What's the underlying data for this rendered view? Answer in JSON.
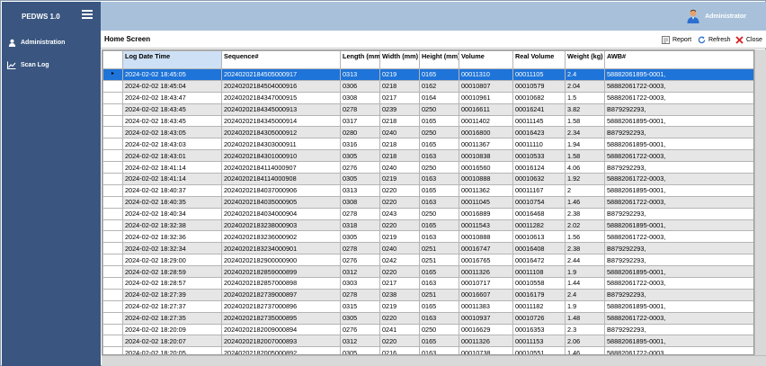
{
  "app": {
    "title": "PEDWS 1.0"
  },
  "sidebar": {
    "items": [
      {
        "label": "Administration",
        "icon": "user-icon"
      },
      {
        "label": "Scan Log",
        "icon": "chart-icon"
      }
    ]
  },
  "topbar": {
    "user_name": "Administrator"
  },
  "page": {
    "title": "Home Screen",
    "buttons": {
      "report": "Report",
      "refresh": "Refresh",
      "close": "Close"
    }
  },
  "colors": {
    "sidebar": "#3a5680",
    "topbar": "#a8c0d9",
    "selected_row": "#1e74d8",
    "sorted_header": "#cde0f5"
  },
  "table": {
    "columns": [
      "Log Date Time",
      "Sequence#",
      "Length (mm)",
      "Width (mm)",
      "Height (mm)",
      "Volume",
      "Real Volume",
      "Weight (kg)",
      "AWB#"
    ],
    "rows": [
      [
        "2024-02-02 18:45:05",
        "20240202184505000917",
        "0313",
        "0219",
        "0165",
        "00011310",
        "00011105",
        "2.4",
        "58882061895-0001,"
      ],
      [
        "2024-02-02 18:45:04",
        "20240202184504000916",
        "0306",
        "0218",
        "0162",
        "00010807",
        "00010579",
        "2.04",
        "58882061722-0003,"
      ],
      [
        "2024-02-02 18:43:47",
        "20240202184347000915",
        "0308",
        "0217",
        "0164",
        "00010961",
        "00010682",
        "1.5",
        "58882061722-0003,"
      ],
      [
        "2024-02-02 18:43:45",
        "20240202184345000913",
        "0278",
        "0239",
        "0250",
        "00016611",
        "00016241",
        "3.82",
        "B879292293,"
      ],
      [
        "2024-02-02 18:43:45",
        "20240202184345000914",
        "0317",
        "0218",
        "0165",
        "00011402",
        "00011145",
        "1.58",
        "58882061895-0001,"
      ],
      [
        "2024-02-02 18:43:05",
        "20240202184305000912",
        "0280",
        "0240",
        "0250",
        "00016800",
        "00016423",
        "2.34",
        "B879292293,"
      ],
      [
        "2024-02-02 18:43:03",
        "20240202184303000911",
        "0316",
        "0218",
        "0165",
        "00011367",
        "00011110",
        "1.94",
        "58882061895-0001,"
      ],
      [
        "2024-02-02 18:43:01",
        "20240202184301000910",
        "0305",
        "0218",
        "0163",
        "00010838",
        "00010533",
        "1.58",
        "58882061722-0003,"
      ],
      [
        "2024-02-02 18:41:14",
        "20240202184114000907",
        "0276",
        "0240",
        "0250",
        "00016560",
        "00016124",
        "4.06",
        "B879292293,"
      ],
      [
        "2024-02-02 18:41:14",
        "20240202184114000908",
        "0305",
        "0219",
        "0163",
        "00010888",
        "00010632",
        "1.92",
        "58882061722-0003,"
      ],
      [
        "2024-02-02 18:40:37",
        "20240202184037000906",
        "0313",
        "0220",
        "0165",
        "00011362",
        "00011167",
        "2",
        "58882061895-0001,"
      ],
      [
        "2024-02-02 18:40:35",
        "20240202184035000905",
        "0308",
        "0220",
        "0163",
        "00011045",
        "00010754",
        "1.46",
        "58882061722-0003,"
      ],
      [
        "2024-02-02 18:40:34",
        "20240202184034000904",
        "0278",
        "0243",
        "0250",
        "00016889",
        "00016468",
        "2.38",
        "B879292293,"
      ],
      [
        "2024-02-02 18:32:38",
        "20240202183238000903",
        "0318",
        "0220",
        "0165",
        "00011543",
        "00011282",
        "2.02",
        "58882061895-0001,"
      ],
      [
        "2024-02-02 18:32:36",
        "20240202183236000902",
        "0305",
        "0219",
        "0163",
        "00010888",
        "00010613",
        "1.56",
        "58882061722-0003,"
      ],
      [
        "2024-02-02 18:32:34",
        "20240202183234000901",
        "0278",
        "0240",
        "0251",
        "00016747",
        "00016408",
        "2.38",
        "B879292293,"
      ],
      [
        "2024-02-02 18:29:00",
        "20240202182900000900",
        "0276",
        "0242",
        "0251",
        "00016765",
        "00016472",
        "2.44",
        "B879292293,"
      ],
      [
        "2024-02-02 18:28:59",
        "20240202182859000899",
        "0312",
        "0220",
        "0165",
        "00011326",
        "00011108",
        "1.9",
        "58882061895-0001,"
      ],
      [
        "2024-02-02 18:28:57",
        "20240202182857000898",
        "0303",
        "0217",
        "0163",
        "00010717",
        "00010558",
        "1.44",
        "58882061722-0003,"
      ],
      [
        "2024-02-02 18:27:39",
        "20240202182739000897",
        "0278",
        "0238",
        "0251",
        "00016607",
        "00016179",
        "2.4",
        "B879292293,"
      ],
      [
        "2024-02-02 18:27:37",
        "20240202182737000896",
        "0315",
        "0219",
        "0165",
        "00011383",
        "00011182",
        "1.9",
        "58882061895-0001,"
      ],
      [
        "2024-02-02 18:27:35",
        "20240202182735000895",
        "0305",
        "0220",
        "0163",
        "00010937",
        "00010726",
        "1.48",
        "58882061722-0003,"
      ],
      [
        "2024-02-02 18:20:09",
        "20240202182009000894",
        "0276",
        "0241",
        "0250",
        "00016629",
        "00016353",
        "2.3",
        "B879292293,"
      ],
      [
        "2024-02-02 18:20:07",
        "20240202182007000893",
        "0312",
        "0220",
        "0165",
        "00011326",
        "00011153",
        "2.06",
        "58882061895-0001,"
      ],
      [
        "2024-02-02 18:20:05",
        "20240202182005000892",
        "0305",
        "0216",
        "0163",
        "00010738",
        "00010551",
        "1.46",
        "58882061722-0003,"
      ]
    ]
  }
}
